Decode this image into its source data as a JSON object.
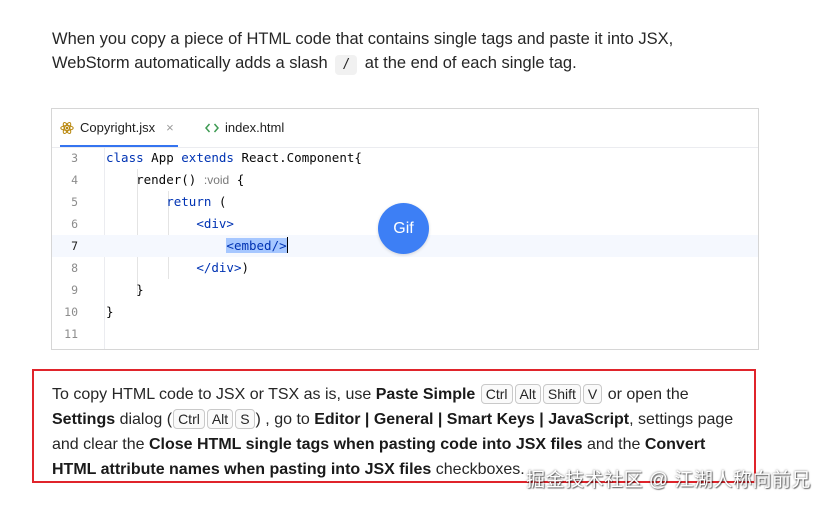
{
  "intro": {
    "line1": "When you copy a piece of HTML code that contains single tags and paste it into JSX,",
    "line2_before": "WebStorm automatically adds a slash",
    "slash": "/",
    "line2_after": "at the end of each single tag."
  },
  "editor": {
    "tabs": [
      {
        "label": "Copyright.jsx",
        "icon": "react-icon",
        "active": true,
        "close": "×"
      },
      {
        "label": "index.html",
        "icon": "code-brackets-icon",
        "active": false
      }
    ],
    "line_numbers": [
      "3",
      "4",
      "5",
      "6",
      "7",
      "8",
      "9",
      "10",
      "11"
    ],
    "code": {
      "l3_kw1": "class",
      "l3_name": " App ",
      "l3_kw2": "extends",
      "l3_rest": " React.Component{",
      "l4_fn": "render()",
      "l4_hint": ":void",
      "l4_brace": " {",
      "l5_kw": "return",
      "l5_paren": " (",
      "l6_tag": "<div>",
      "l7_tag": "<embed/>",
      "l8_tag": "</div>",
      "l8_rest": ")",
      "l9_brace": "}",
      "l10_brace": "}"
    },
    "current_line": "7",
    "gif_label": "Gif"
  },
  "tip": {
    "t1": "To copy HTML code to JSX or TSX as is, use",
    "paste_simple": "Paste Simple",
    "keys1": [
      "Ctrl",
      "Alt",
      "Shift",
      "V"
    ],
    "t2": "or open the",
    "settings": "Settings",
    "t3": "dialog (",
    "keys2": [
      "Ctrl",
      "Alt",
      "S"
    ],
    "t4": ") , go to",
    "path": "Editor | General | Smart Keys | JavaScript",
    "t5": ", settings page",
    "t6": "and clear the",
    "opt1": "Close HTML single tags when pasting code into JSX files",
    "t7": "and the",
    "opt2a": "Convert",
    "opt2b": "HTML attribute names when pasting into JSX files",
    "t8": "checkboxes."
  },
  "watermark": "掘金技术社区 @ 江湖人称向前兄",
  "colors": {
    "accent": "#3574f0",
    "gif_badge": "#3d7ff5",
    "tip_border": "#e0242b",
    "keyword": "#0033b3",
    "selection": "#a6c7ff"
  }
}
